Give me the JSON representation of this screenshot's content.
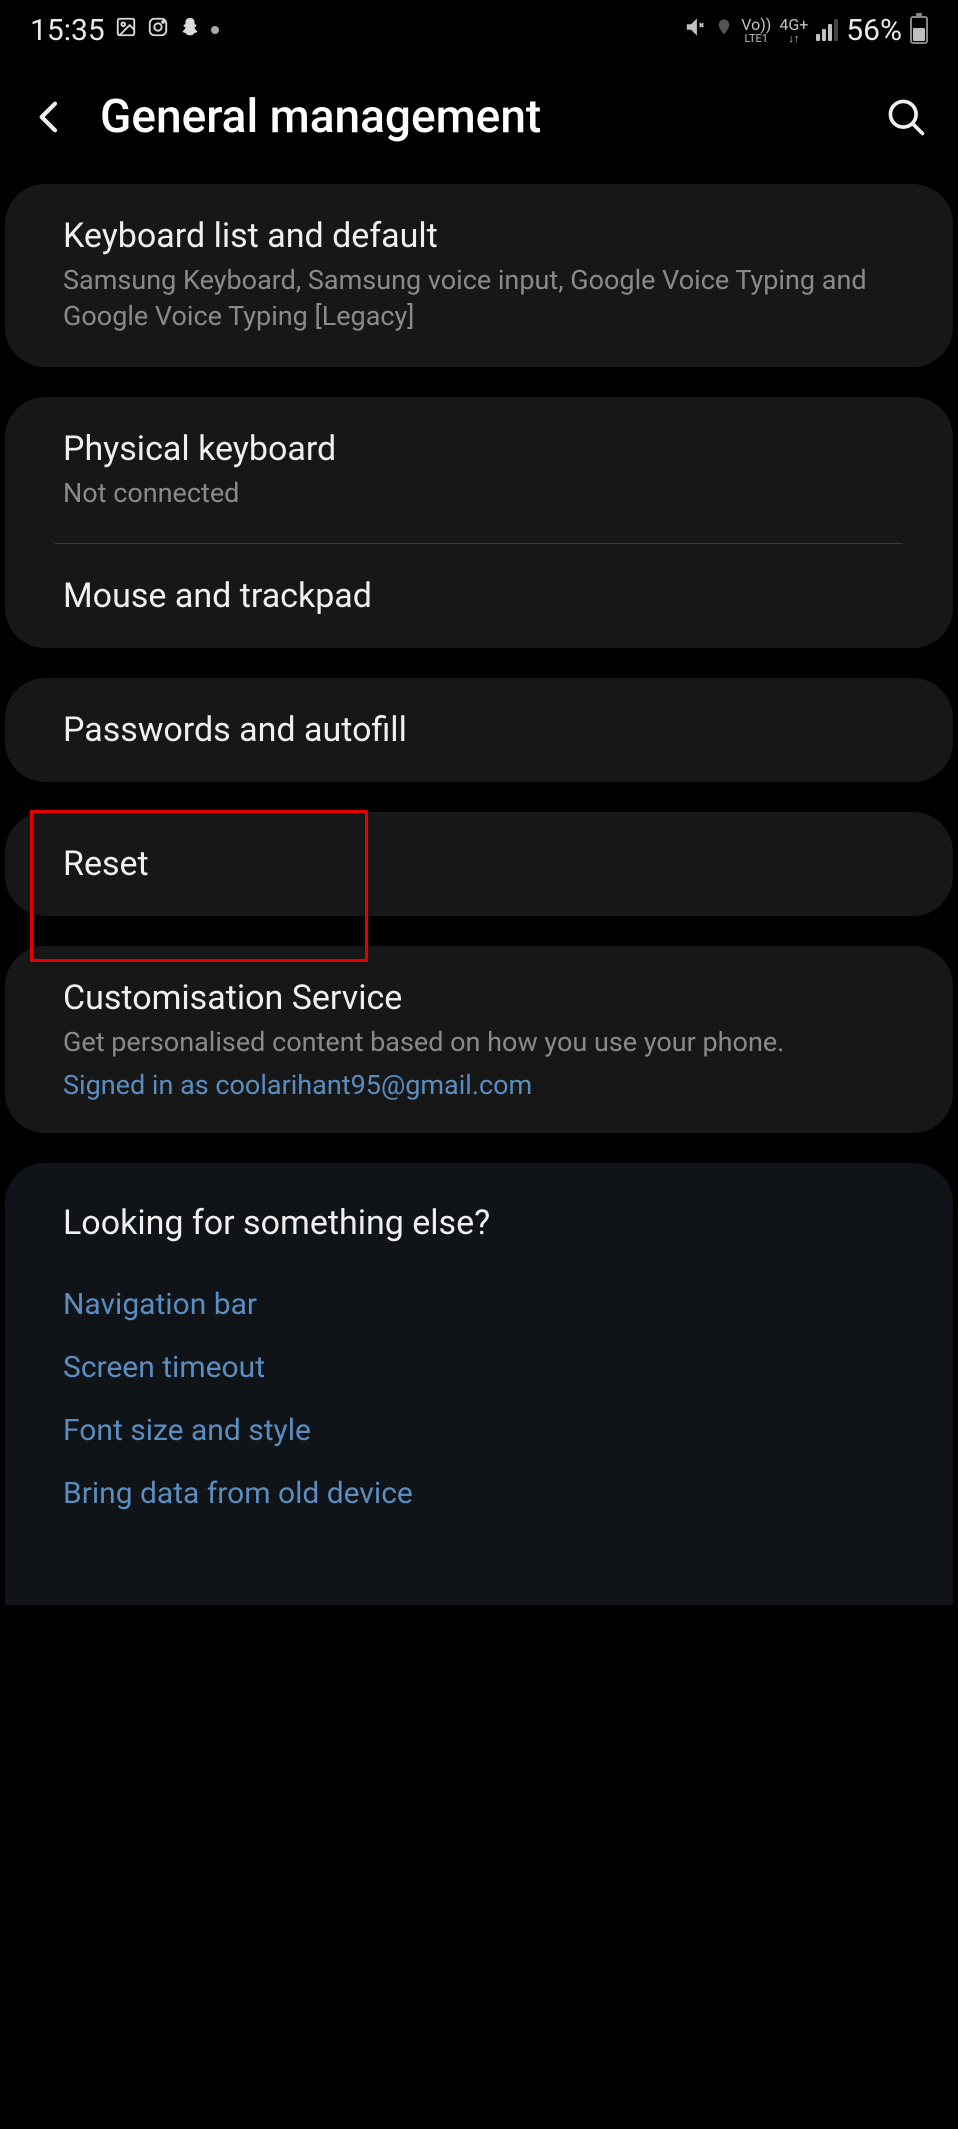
{
  "status": {
    "time": "15:35",
    "battery": "56%",
    "network1": "Vo))",
    "network1_sub": "LTE1",
    "network2": "4G+",
    "network2_sub": "↓↑"
  },
  "header": {
    "title": "General management"
  },
  "cards": [
    {
      "items": [
        {
          "title": "Keyboard list and default",
          "subtitle": "Samsung Keyboard, Samsung voice input, Google Voice Typing and Google Voice Typing [Legacy]"
        }
      ]
    },
    {
      "items": [
        {
          "title": "Physical keyboard",
          "subtitle": "Not connected"
        },
        {
          "title": "Mouse and trackpad"
        }
      ]
    },
    {
      "items": [
        {
          "title": "Passwords and autofill"
        }
      ]
    },
    {
      "items": [
        {
          "title": "Reset",
          "highlighted": true
        }
      ]
    },
    {
      "items": [
        {
          "title": "Customisation Service",
          "subtitle": "Get personalised content based on how you use your phone.",
          "link": "Signed in as coolarihant95@gmail.com"
        }
      ]
    }
  ],
  "bottom": {
    "header": "Looking for something else?",
    "links": [
      "Navigation bar",
      "Screen timeout",
      "Font size and style",
      "Bring data from old device"
    ]
  }
}
